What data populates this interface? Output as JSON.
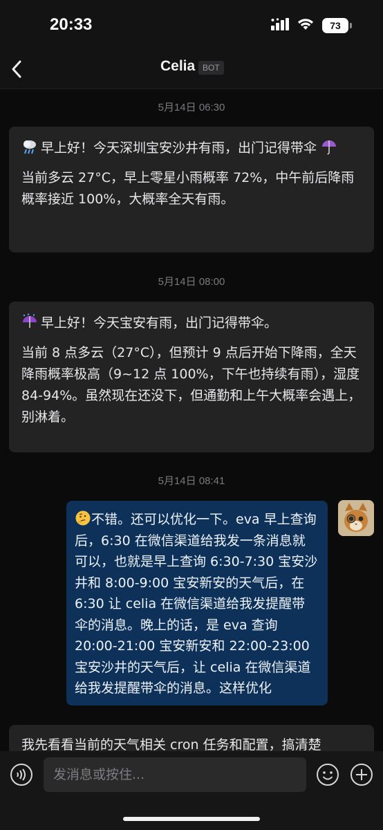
{
  "status_bar": {
    "time": "20:33",
    "battery": "73",
    "icons": [
      "signal-icon",
      "wifi-icon",
      "battery-icon"
    ]
  },
  "nav": {
    "back_icon": "chevron-left-icon",
    "title": "Celia",
    "badge": "BOT"
  },
  "messages": [
    {
      "timestamp": "5月14日 06:30",
      "sender": "bot",
      "icon": "cloud-rain-icon",
      "lead_icon_2": "umbrella-icon",
      "line1": "早上好！今天深圳宝安沙井有雨，出门记得带伞",
      "body": "当前多云 27°C，早上零星小雨概率 72%，中午前后降雨概率接近 100%，大概率全天有雨。"
    },
    {
      "timestamp": "5月14日 08:00",
      "sender": "bot",
      "icon": "umbrella-rain-icon",
      "line1": "早上好！今天宝安有雨，出门记得带伞。",
      "body": "当前 8 点多云（27°C），但预计 9 点后开始下降雨，全天降雨概率极高（9~12 点 100%，下午也持续有雨），湿度 84-94%。虽然现在还没下，但通勤和上午大概率会遇上，别淋着。"
    },
    {
      "timestamp": "5月14日 08:41",
      "sender": "user",
      "icon": "thinking-face-icon",
      "body": "不错。还可以优化一下。eva 早上查询后，6:30 在微信渠道给我发一条消息就可以，也就是早上查询 6:30-7:30 宝安沙井和 8:00-9:00 宝安新安的天气后，在 6:30 让 celia 在微信渠道给我发提醒带伞的消息。晚上的话，是 eva 查询 20:00-21:00 宝安新安和 22:00-23:00 宝安沙井的天气后，让 celia 在微信渠道给我发提醒带伞的消息。这样优化"
    },
    {
      "sender": "bot",
      "body": "我先看看当前的天气相关 cron 任务和配置，搞清楚"
    }
  ],
  "input": {
    "placeholder": "发消息或按住...",
    "voice_icon": "voice-icon",
    "emoji_icon": "emoji-icon",
    "plus_icon": "plus-icon"
  },
  "colors": {
    "background": "#0b0b0c",
    "bot_bubble": "#232324",
    "user_bubble": "#0d3159",
    "timestamp": "#7a7a7c"
  }
}
